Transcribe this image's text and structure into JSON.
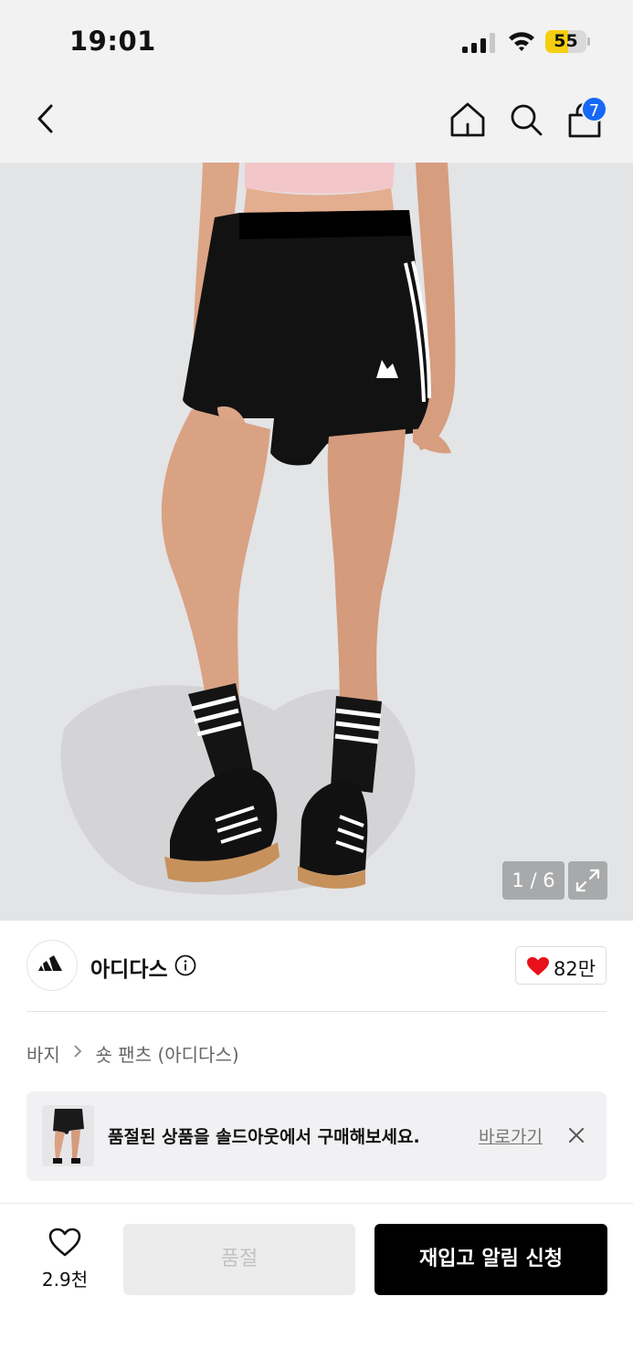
{
  "status_bar": {
    "time": "19:01",
    "battery_level": "55",
    "battery_fraction": 0.55,
    "icons": [
      "signal-icon",
      "wifi-icon",
      "battery-icon"
    ]
  },
  "nav": {
    "icons": [
      "back-icon",
      "home-icon",
      "search-icon",
      "shopping-bag-icon"
    ],
    "cart_count": "7",
    "cart_badge_color": "#1768f5"
  },
  "gallery": {
    "counter": "1 / 6",
    "current": 1,
    "total": 6,
    "expand_icon": "expand-icon",
    "background_color": "#e3e4e6"
  },
  "brand": {
    "name": "아디다스",
    "likes": "82만",
    "heart_color": "#e8101a"
  },
  "breadcrumb": {
    "category": "바지",
    "subcategory": "숏 팬츠 (아디다스)"
  },
  "banner": {
    "message": "품절된 상품을 솔드아웃에서 구매해보세요.",
    "link_label": "바로가기"
  },
  "bottom_bar": {
    "wish_count": "2.9천",
    "soldout_label": "품절",
    "restock_label": "재입고 알림 신청"
  }
}
